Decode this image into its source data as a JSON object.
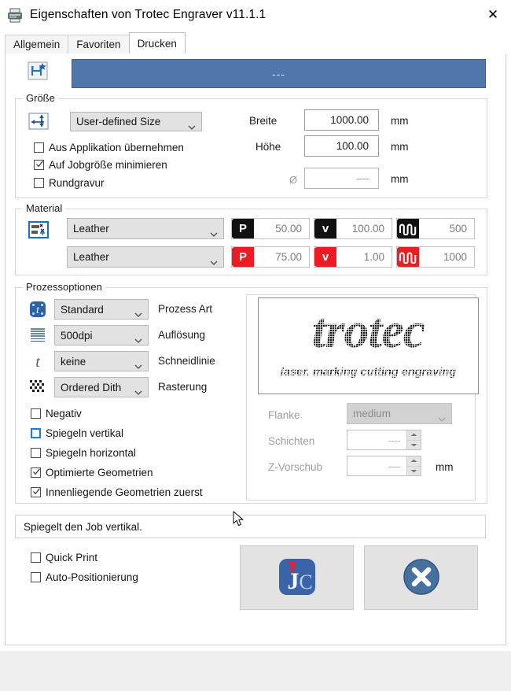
{
  "window": {
    "title": "Eigenschaften von Trotec Engraver v11.1.1",
    "close_label": "✕",
    "app_icon": "printer-icon"
  },
  "tabs": [
    {
      "label": "Allgemein",
      "active": false
    },
    {
      "label": "Favoriten",
      "active": false
    },
    {
      "label": "Drucken",
      "active": true
    }
  ],
  "job": {
    "name_value": "---",
    "save_icon": "save-as-new-icon"
  },
  "size": {
    "legend": "Größe",
    "icon": "size-dimensions-icon",
    "preset": "User-defined Size",
    "checkboxes": [
      {
        "label": "Aus Applikation übernehmen",
        "checked": false
      },
      {
        "label": "Auf Jobgröße minimieren",
        "checked": true
      },
      {
        "label": "Rundgravur",
        "checked": false
      }
    ],
    "width_label": "Breite",
    "width_value": "1000.00",
    "height_label": "Höhe",
    "height_value": "100.00",
    "diameter_symbol": "Ø",
    "diameter_value": "----",
    "unit": "mm"
  },
  "material": {
    "legend": "Material",
    "icon": "material-icon",
    "rows": [
      {
        "name": "Leather",
        "color": "#111111",
        "power": {
          "badge": "P",
          "value": "50.00"
        },
        "velocity": {
          "badge": "v",
          "value": "100.00"
        },
        "frequency": {
          "badge": "frequency-wave-icon",
          "value": "500"
        }
      },
      {
        "name": "Leather",
        "color": "#ed1c24",
        "power": {
          "badge": "P",
          "value": "75.00"
        },
        "velocity": {
          "badge": "v",
          "value": "1.00"
        },
        "frequency": {
          "badge": "frequency-wave-icon",
          "value": "1000"
        }
      }
    ]
  },
  "process": {
    "legend": "Prozessoptionen",
    "rows": [
      {
        "icon": "process-type-icon",
        "value": "Standard",
        "label": "Prozess Art"
      },
      {
        "icon": "resolution-lines-icon",
        "value": "500dpi",
        "label": "Auflösung"
      },
      {
        "icon": "cut-line-t-icon",
        "value": "keine",
        "label": "Schneidlinie"
      },
      {
        "icon": "dither-pattern-icon",
        "value": "Ordered Dith",
        "label": "Rasterung"
      }
    ],
    "checkboxes": [
      {
        "label": "Negativ",
        "checked": false,
        "focused": false
      },
      {
        "label": "Spiegeln vertikal",
        "checked": false,
        "focused": true
      },
      {
        "label": "Spiegeln horizontal",
        "checked": false,
        "focused": false
      },
      {
        "label": "Optimierte Geometrien",
        "checked": true,
        "focused": false
      },
      {
        "label": "Innenliegende Geometrien zuerst",
        "checked": true,
        "focused": false
      }
    ]
  },
  "preview": {
    "logo_text": "trotec",
    "tagline": "laser. marking cutting engraving"
  },
  "advanced": {
    "flank_label": "Flanke",
    "flank_value": "medium",
    "layers_label": "Schichten",
    "layers_value": "----",
    "zfeed_label": "Z-Vorschub",
    "zfeed_value": "----",
    "zfeed_unit": "mm"
  },
  "status": {
    "text": "Spiegelt den Job vertikal."
  },
  "footer": {
    "checkboxes": [
      {
        "label": "Quick Print",
        "checked": false
      },
      {
        "label": "Auto-Positionierung",
        "checked": false
      }
    ],
    "primary_button": {
      "name": "jobcontrol-button",
      "icon": "jobcontrol-jc-icon"
    },
    "cancel_button": {
      "name": "cancel-button",
      "icon": "cancel-x-circle-icon"
    }
  },
  "colors": {
    "job_bar": "#5176ab",
    "accent_blue": "#1a7fd4",
    "material_black": "#111111",
    "material_red": "#ed1c24"
  }
}
